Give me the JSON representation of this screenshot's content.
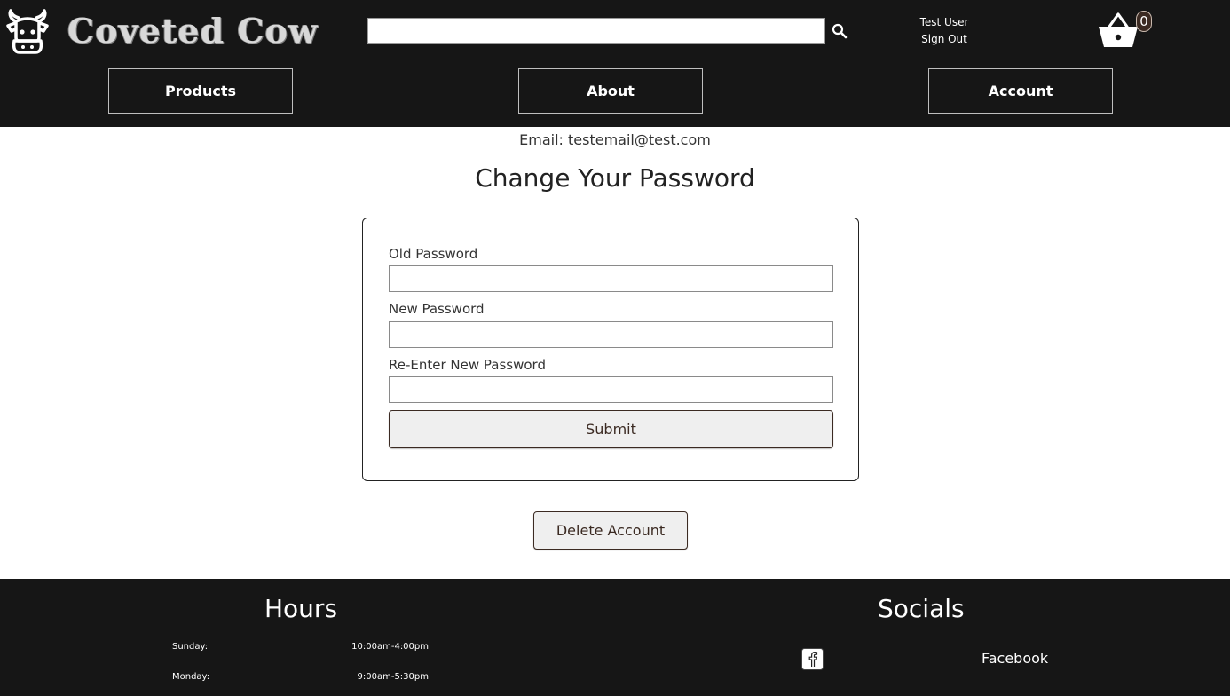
{
  "header": {
    "brand_name": "Coveted Cow",
    "logo_icon": "cow-head-icon",
    "search": {
      "value": "",
      "placeholder": ""
    },
    "user": {
      "name": "Test User",
      "sign_out_label": "Sign Out"
    },
    "cart": {
      "count": "0"
    }
  },
  "nav": {
    "items": [
      "Products",
      "About",
      "Account"
    ]
  },
  "account": {
    "email_line": "Email: testemail@test.com",
    "change_password": {
      "title": "Change Your Password",
      "old_label": "Old Password",
      "new_label": "New Password",
      "reenter_label": "Re-Enter New Password",
      "submit_label": "Submit"
    },
    "delete_label": "Delete Account"
  },
  "footer": {
    "hours": {
      "title": "Hours",
      "rows": [
        {
          "day": "Sunday:",
          "time": "10:00am-4:00pm"
        },
        {
          "day": "Monday:",
          "time": "9:00am-5:30pm"
        }
      ]
    },
    "socials": {
      "title": "Socials",
      "items": [
        {
          "label": "Facebook",
          "icon": "facebook-icon"
        }
      ]
    }
  },
  "colors": {
    "header_bg": "#161616",
    "button_border": "#3b2a22",
    "button_bg": "#efefef"
  }
}
